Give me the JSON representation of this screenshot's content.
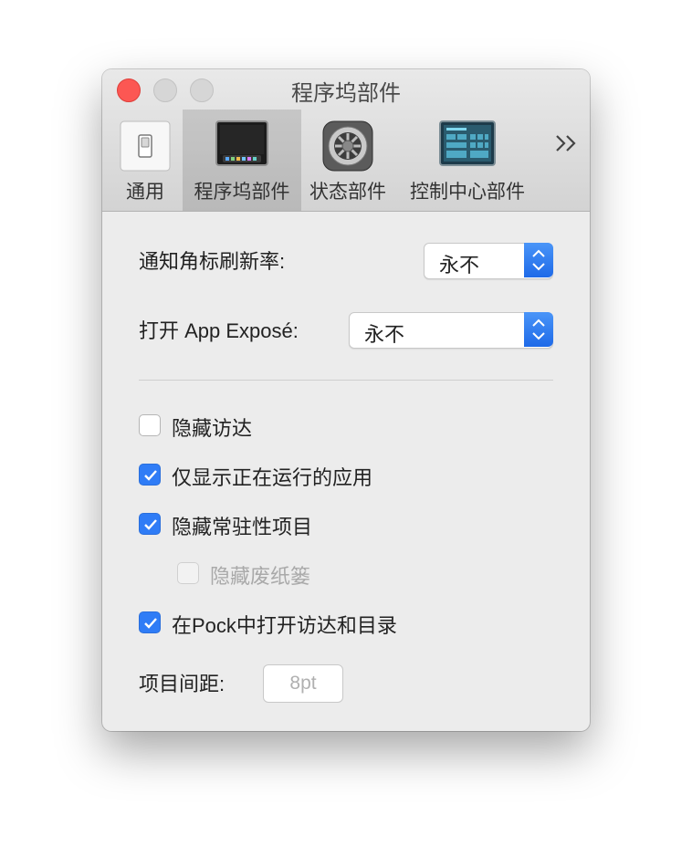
{
  "window": {
    "title": "程序坞部件"
  },
  "toolbar": {
    "tabs": [
      {
        "label": "通用",
        "icon": "switch-icon",
        "active": false
      },
      {
        "label": "程序坞部件",
        "icon": "dock-icon",
        "active": true
      },
      {
        "label": "状态部件",
        "icon": "gear-icon",
        "active": false
      },
      {
        "label": "控制中心部件",
        "icon": "control-center-icon",
        "active": false
      }
    ],
    "more_label": "»"
  },
  "settings": {
    "badge_refresh": {
      "label": "通知角标刷新率:",
      "value": "永不"
    },
    "app_expose": {
      "label": "打开 App Exposé:",
      "value": "永不"
    }
  },
  "checkboxes": [
    {
      "label": "隐藏访达",
      "checked": false,
      "enabled": true
    },
    {
      "label": "仅显示正在运行的应用",
      "checked": true,
      "enabled": true
    },
    {
      "label": "隐藏常驻性项目",
      "checked": true,
      "enabled": true
    },
    {
      "label": "隐藏废纸篓",
      "checked": false,
      "enabled": false
    },
    {
      "label": "在Pock中打开访达和目录",
      "checked": true,
      "enabled": true
    }
  ],
  "spacing": {
    "label": "项目间距:",
    "placeholder": "8pt"
  },
  "colors": {
    "accent": "#2f7cf6",
    "close_button": "#fc5753"
  }
}
